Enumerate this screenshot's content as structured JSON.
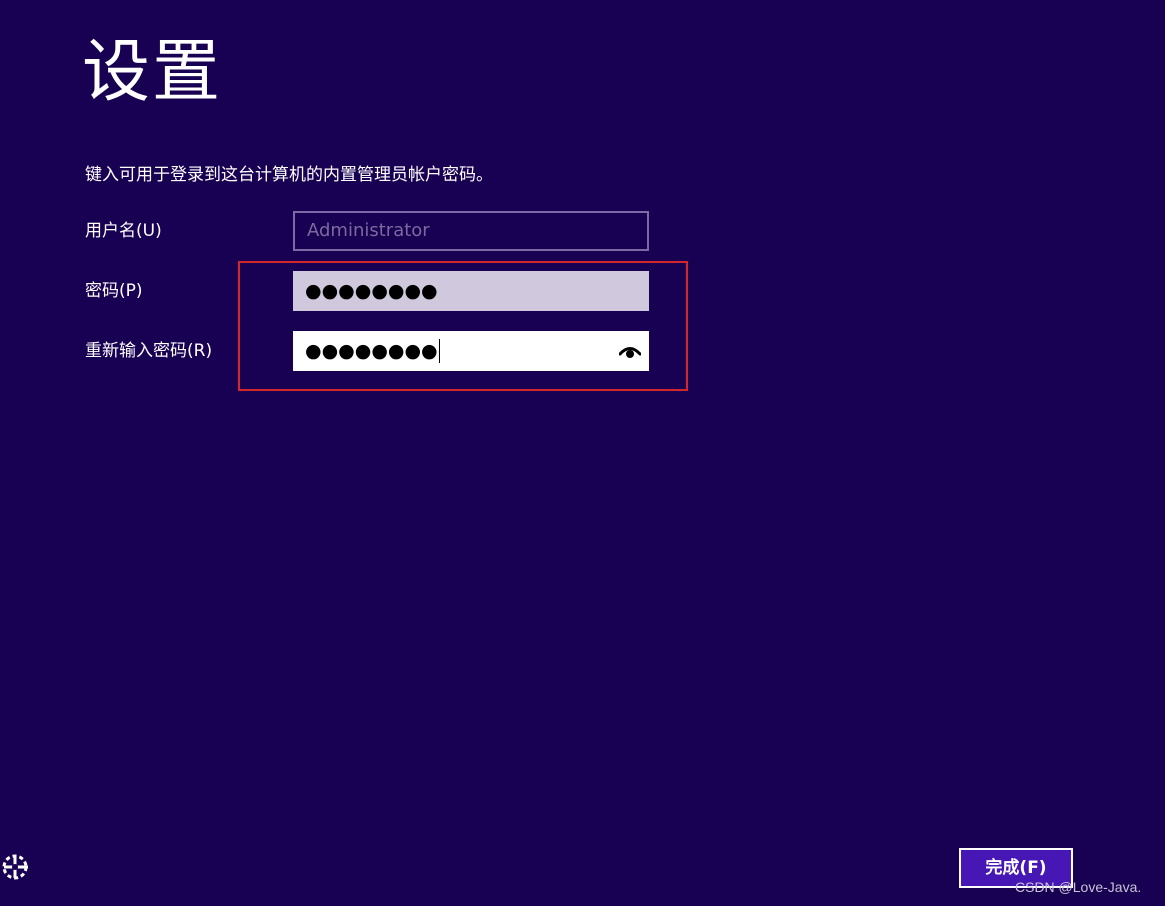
{
  "page": {
    "title": "设置",
    "instruction": "键入可用于登录到这台计算机的内置管理员帐户密码。"
  },
  "form": {
    "username_label": "用户名(U)",
    "username_placeholder": "Administrator",
    "password_label": "密码(P)",
    "password_mask": "●●●●●●●●",
    "confirm_label": "重新输入密码(R)",
    "confirm_mask": "●●●●●●●●"
  },
  "icons": {
    "reveal": "eye-icon",
    "accessibility": "ease-of-access-icon"
  },
  "footer": {
    "finish_label": "完成(F)",
    "watermark": "CSDN @Love-Java."
  },
  "colors": {
    "background": "#180052",
    "button": "#4617b4",
    "highlight": "#d6262d"
  }
}
